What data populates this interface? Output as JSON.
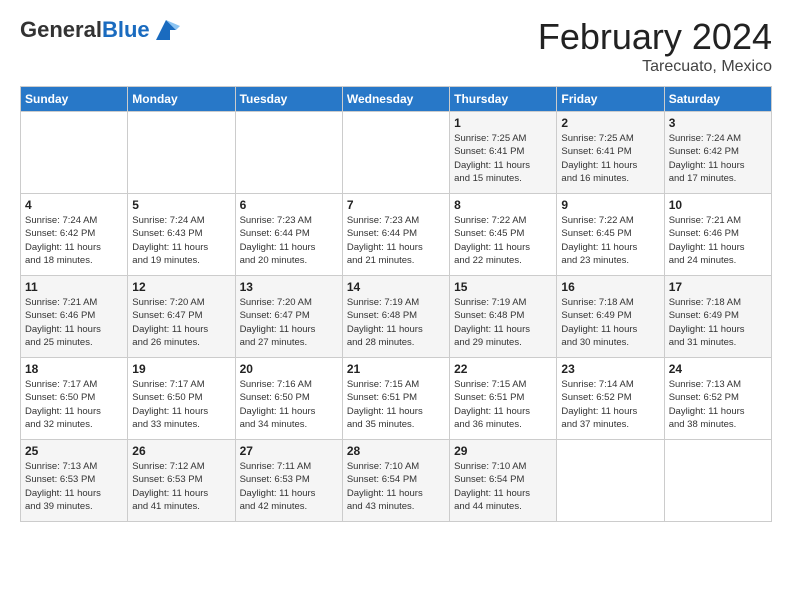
{
  "header": {
    "logo_general": "General",
    "logo_blue": "Blue",
    "title": "February 2024",
    "subtitle": "Tarecuato, Mexico"
  },
  "weekdays": [
    "Sunday",
    "Monday",
    "Tuesday",
    "Wednesday",
    "Thursday",
    "Friday",
    "Saturday"
  ],
  "weeks": [
    [
      {
        "day": "",
        "info": ""
      },
      {
        "day": "",
        "info": ""
      },
      {
        "day": "",
        "info": ""
      },
      {
        "day": "",
        "info": ""
      },
      {
        "day": "1",
        "info": "Sunrise: 7:25 AM\nSunset: 6:41 PM\nDaylight: 11 hours\nand 15 minutes."
      },
      {
        "day": "2",
        "info": "Sunrise: 7:25 AM\nSunset: 6:41 PM\nDaylight: 11 hours\nand 16 minutes."
      },
      {
        "day": "3",
        "info": "Sunrise: 7:24 AM\nSunset: 6:42 PM\nDaylight: 11 hours\nand 17 minutes."
      }
    ],
    [
      {
        "day": "4",
        "info": "Sunrise: 7:24 AM\nSunset: 6:42 PM\nDaylight: 11 hours\nand 18 minutes."
      },
      {
        "day": "5",
        "info": "Sunrise: 7:24 AM\nSunset: 6:43 PM\nDaylight: 11 hours\nand 19 minutes."
      },
      {
        "day": "6",
        "info": "Sunrise: 7:23 AM\nSunset: 6:44 PM\nDaylight: 11 hours\nand 20 minutes."
      },
      {
        "day": "7",
        "info": "Sunrise: 7:23 AM\nSunset: 6:44 PM\nDaylight: 11 hours\nand 21 minutes."
      },
      {
        "day": "8",
        "info": "Sunrise: 7:22 AM\nSunset: 6:45 PM\nDaylight: 11 hours\nand 22 minutes."
      },
      {
        "day": "9",
        "info": "Sunrise: 7:22 AM\nSunset: 6:45 PM\nDaylight: 11 hours\nand 23 minutes."
      },
      {
        "day": "10",
        "info": "Sunrise: 7:21 AM\nSunset: 6:46 PM\nDaylight: 11 hours\nand 24 minutes."
      }
    ],
    [
      {
        "day": "11",
        "info": "Sunrise: 7:21 AM\nSunset: 6:46 PM\nDaylight: 11 hours\nand 25 minutes."
      },
      {
        "day": "12",
        "info": "Sunrise: 7:20 AM\nSunset: 6:47 PM\nDaylight: 11 hours\nand 26 minutes."
      },
      {
        "day": "13",
        "info": "Sunrise: 7:20 AM\nSunset: 6:47 PM\nDaylight: 11 hours\nand 27 minutes."
      },
      {
        "day": "14",
        "info": "Sunrise: 7:19 AM\nSunset: 6:48 PM\nDaylight: 11 hours\nand 28 minutes."
      },
      {
        "day": "15",
        "info": "Sunrise: 7:19 AM\nSunset: 6:48 PM\nDaylight: 11 hours\nand 29 minutes."
      },
      {
        "day": "16",
        "info": "Sunrise: 7:18 AM\nSunset: 6:49 PM\nDaylight: 11 hours\nand 30 minutes."
      },
      {
        "day": "17",
        "info": "Sunrise: 7:18 AM\nSunset: 6:49 PM\nDaylight: 11 hours\nand 31 minutes."
      }
    ],
    [
      {
        "day": "18",
        "info": "Sunrise: 7:17 AM\nSunset: 6:50 PM\nDaylight: 11 hours\nand 32 minutes."
      },
      {
        "day": "19",
        "info": "Sunrise: 7:17 AM\nSunset: 6:50 PM\nDaylight: 11 hours\nand 33 minutes."
      },
      {
        "day": "20",
        "info": "Sunrise: 7:16 AM\nSunset: 6:50 PM\nDaylight: 11 hours\nand 34 minutes."
      },
      {
        "day": "21",
        "info": "Sunrise: 7:15 AM\nSunset: 6:51 PM\nDaylight: 11 hours\nand 35 minutes."
      },
      {
        "day": "22",
        "info": "Sunrise: 7:15 AM\nSunset: 6:51 PM\nDaylight: 11 hours\nand 36 minutes."
      },
      {
        "day": "23",
        "info": "Sunrise: 7:14 AM\nSunset: 6:52 PM\nDaylight: 11 hours\nand 37 minutes."
      },
      {
        "day": "24",
        "info": "Sunrise: 7:13 AM\nSunset: 6:52 PM\nDaylight: 11 hours\nand 38 minutes."
      }
    ],
    [
      {
        "day": "25",
        "info": "Sunrise: 7:13 AM\nSunset: 6:53 PM\nDaylight: 11 hours\nand 39 minutes."
      },
      {
        "day": "26",
        "info": "Sunrise: 7:12 AM\nSunset: 6:53 PM\nDaylight: 11 hours\nand 41 minutes."
      },
      {
        "day": "27",
        "info": "Sunrise: 7:11 AM\nSunset: 6:53 PM\nDaylight: 11 hours\nand 42 minutes."
      },
      {
        "day": "28",
        "info": "Sunrise: 7:10 AM\nSunset: 6:54 PM\nDaylight: 11 hours\nand 43 minutes."
      },
      {
        "day": "29",
        "info": "Sunrise: 7:10 AM\nSunset: 6:54 PM\nDaylight: 11 hours\nand 44 minutes."
      },
      {
        "day": "",
        "info": ""
      },
      {
        "day": "",
        "info": ""
      }
    ]
  ]
}
